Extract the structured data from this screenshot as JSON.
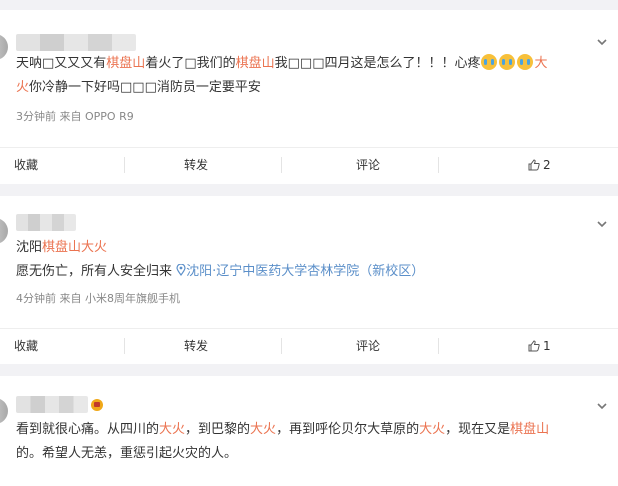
{
  "post1": {
    "seg1": "天呐□又又又有",
    "seg2": "棋盘山",
    "seg3": "着火了□我们的",
    "seg4": "棋盘山",
    "seg5": "我□□□四月这是怎么了！！！心疼",
    "seg6": "大",
    "seg7": "火",
    "seg8": "你冷静一下好吗□□□消防员一定要平安",
    "meta": "3分钟前 来自 OPPO R9",
    "collect": "收藏",
    "repost": "转发",
    "comment": "评论",
    "likes": "2"
  },
  "post2": {
    "line1_a": "沈阳",
    "line1_b": "棋盘山大火",
    "line2": "愿无伤亡，所有人安全归来",
    "location": "沈阳·辽宁中医药大学杏林学院（新校区）",
    "meta": "4分钟前 来自 小米8周年旗舰手机",
    "collect": "收藏",
    "repost": "转发",
    "comment": "评论",
    "likes": "1"
  },
  "post3": {
    "s1": "看到就很心痛。从四川的",
    "s2": "大火",
    "s3": "，到巴黎的",
    "s4": "大火",
    "s5": "，再到呼伦贝尔大草原的",
    "s6": "大火",
    "s7": "，现在又是",
    "s8": "棋盘山",
    "s9": "的。希望人无恙，重惩引起火灾的人。"
  },
  "icons": [
    "chevron-down-icon",
    "thumb-up-icon",
    "location-pin-icon",
    "crying-emoji-icon",
    "vip-badge-icon"
  ],
  "colors": {
    "highlight": "#eb7350",
    "location": "#5b8fc9",
    "meta": "#888888",
    "background": "#f2f2f5"
  }
}
